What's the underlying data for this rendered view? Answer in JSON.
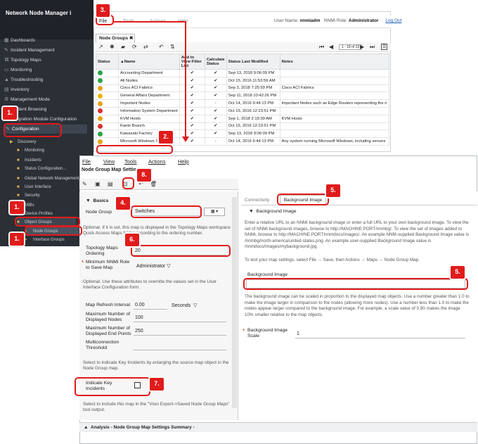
{
  "nav": {
    "app_title": "Network Node Manager i",
    "items": [
      {
        "label": "Dashboards",
        "icon": "dashboard-icon"
      },
      {
        "label": "Incident Management",
        "icon": "wrench-icon"
      },
      {
        "label": "Topology Maps",
        "icon": "topology-icon"
      },
      {
        "label": "Monitoring",
        "icon": "monitor-icon"
      },
      {
        "label": "Troubleshooting",
        "icon": "warning-icon"
      },
      {
        "label": "Inventory",
        "icon": "inventory-icon"
      },
      {
        "label": "Management Mode",
        "icon": "gear-icon"
      },
      {
        "label": "Incident Browsing",
        "icon": "browse-icon"
      },
      {
        "label": "Integration Module Configuration",
        "icon": "plug-icon"
      },
      {
        "label": "Configuration",
        "icon": "wrench-icon"
      }
    ],
    "sub_items": [
      "Discovery",
      "Monitoring",
      "Incidents",
      "Status Configuration...",
      "Global Network Management",
      "User Interface",
      "Security",
      "MIBs",
      "Device Profiles",
      "Object Groups",
      "Node Groups",
      "Interface Groups"
    ]
  },
  "topbar": {
    "menus": [
      "File",
      "Tools",
      "Actions",
      "Help"
    ],
    "user_label": "User Name:",
    "user_name": "nnmiadm",
    "role_label": "NNMi Role:",
    "role": "Administrator",
    "logout": "Log Out"
  },
  "node_groups": {
    "tab_label": "Node Groups",
    "paging": "1 - 18 of 22",
    "columns": [
      "Status",
      "▲Name",
      "Add to View Filter List",
      "Calculate Status",
      "Status Last Modified",
      "Notes"
    ],
    "rows": [
      {
        "status": "normal",
        "name": "Accounting Department",
        "filter": "✔",
        "calc": "✔",
        "modified": "Sep 13, 2018 9:06:09 PM",
        "notes": ""
      },
      {
        "status": "normal",
        "name": "All Nodes",
        "filter": "✔",
        "calc": "✔",
        "modified": "Oct 15, 2016 11:53:56 AM",
        "notes": ""
      },
      {
        "status": "unk",
        "name": "Cisco ACI Fabrics",
        "filter": "✔",
        "calc": "✔",
        "modified": "Sep 3, 2018 7:25:59 PM",
        "notes": "Cisco ACI Fabrics"
      },
      {
        "status": "warn",
        "name": "General Affairs Department",
        "filter": "✔",
        "calc": "✔",
        "modified": "Sep 11, 2018 10:42:26 PM",
        "notes": ""
      },
      {
        "status": "unk",
        "name": "Important Nodes",
        "filter": "✔",
        "calc": "-",
        "modified": "Oct 14, 2016 9:44:13 PM",
        "notes": "Important Nodes such as Edge Routers representing the n"
      },
      {
        "status": "crit",
        "name": "Information System Department",
        "filter": "✔",
        "calc": "✔",
        "modified": "Oct 15, 2016 12:23:51 PM",
        "notes": ""
      },
      {
        "status": "unk",
        "name": "KVM Hosts",
        "filter": "✔",
        "calc": "✔",
        "modified": "Sep 1, 2018 2:19:39 AM",
        "notes": "KVM Hosts"
      },
      {
        "status": "crit",
        "name": "Kanto Branch",
        "filter": "✔",
        "calc": "✔",
        "modified": "Oct 15, 2016 12:23:51 PM",
        "notes": ""
      },
      {
        "status": "normal",
        "name": "Kawasaki Factory",
        "filter": "✔",
        "calc": "✔",
        "modified": "Sep 13, 2018 9:06:09 PM",
        "notes": ""
      },
      {
        "status": "unk",
        "name": "Microsoft Windows Systems",
        "filter": "✔",
        "calc": "-",
        "modified": "Oct 14, 2016 9:44:13 PM",
        "notes": "Any system running Microsoft Windows, including servers"
      }
    ]
  },
  "form": {
    "menus": [
      "File",
      "View",
      "Tools",
      "Actions",
      "Help"
    ],
    "title": "Node Group Map Settings",
    "basics": "Basics",
    "node_group_label": "Node Group",
    "node_group_value": "Switches",
    "note1": "Optional. If it is set, this map is displayed in the Topology Maps workspace Quick Access Maps folder according to the ordering number.",
    "ordering_label": "Topology Maps Ordering",
    "ordering_value": "20",
    "min_role_label": "Minimum NNMi Role to Save Map",
    "min_role_value": "Administrator",
    "note2": "Optional. Use these attributes to override the values set in the User Interface Configuration form.",
    "refresh_label": "Map Refresh Interval",
    "refresh_value": "0.00",
    "refresh_unit": "Seconds",
    "max_nodes_label": "Maximum Number of Displayed Nodes",
    "max_nodes_value": "100",
    "max_end_label": "Maximum Number of Displayed End Points",
    "max_end_value": "250",
    "multi_label": "Multiconnection Threshold",
    "note3": "Select to indicate Key Incidents by enlarging the source map object in the Node Group map.",
    "key_inc_label": "Indicate Key Incidents",
    "note4": "Select to include this map in the \"Visio Export->Saved Node Group Maps\" tool output.",
    "bottom_section": "Analysis - Node Group Map Settings Summary -"
  },
  "right": {
    "tab_connectivity": "Connectivity",
    "tab_background": "Background Image",
    "section": "Background Image",
    "para1": "Enter a relative URL to an NNMi background image or enter a full URL to your own background image. To view the set of NNMi background images, browse to http://MACHINE:PORT/nnmbg/. To view the set of images added to NNMi, browse to http://MACHINE:PORT/nnmdocs/images/. An example NNM-supplied Background Image value is /nnmbg/north-america/united-states.png. An example user-supplied Background Image value is /nnmdocs/images/mybackground.jpg.",
    "para2": "To test your map settings, select File → Save, then Actions → Maps → Node Group Map.",
    "bg_label": "Background Image",
    "bg_value": "",
    "para3": "The background image can be scaled in proportion to the displayed map objects. Use a number greater than 1.0 to make the image larger in comparison to the nodes (allowing more nodes). Use a number less than 1.0 to make the nodes appear larger compared to the background image. For example, a scale value of 0.90 makes the image 10% smaller relative to the map objects.",
    "scale_label": "Background Image Scale",
    "scale_value": "1"
  },
  "callouts": {
    "c1a": "1.",
    "c1b": "1.",
    "c1c": "1.",
    "c2": "2.",
    "c3": "3.",
    "c4": "4.",
    "c5a": "5.",
    "c5b": "5.",
    "c6": "6.",
    "c7": "7.",
    "c8": "8."
  },
  "colors": {
    "callout": "#e01b1b",
    "nav_bg": "#2b2f36"
  }
}
